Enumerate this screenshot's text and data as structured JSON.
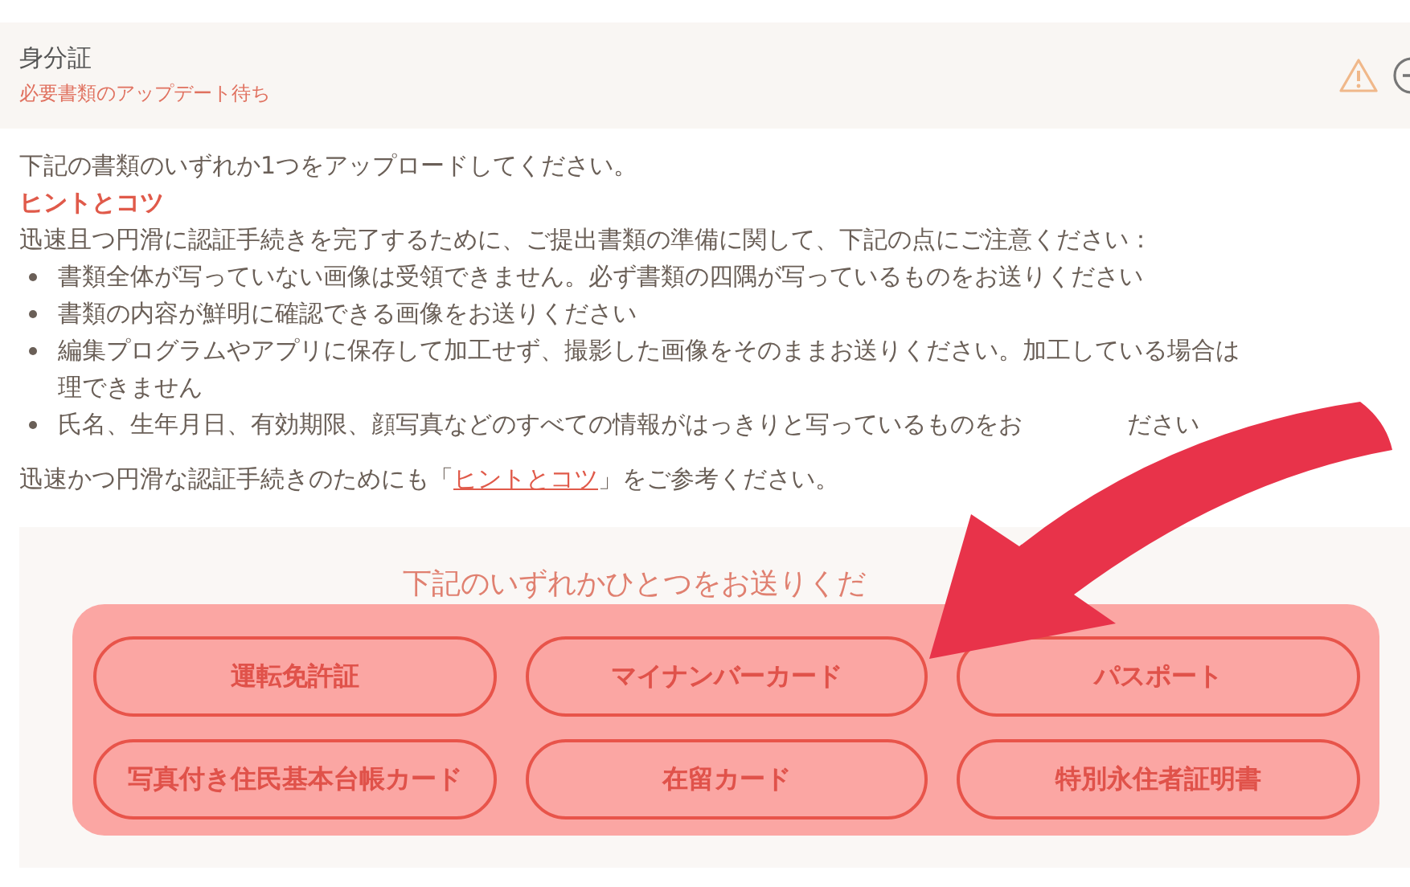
{
  "header": {
    "title": "身分証",
    "status": "必要書類のアップデート待ち"
  },
  "intro": "下記の書類のいずれか1つをアップロードしてください。",
  "hint_heading": "ヒントとコツ",
  "hint_lead": "迅速且つ円滑に認証手続きを完了するために、ご提出書類の準備に関して、下記の点にご注意ください：",
  "bullets": [
    {
      "text": "書類全体が写っていない画像は受領できません。必ず書類の四隅が写っているものをお送りください"
    },
    {
      "text": "書類の内容が鮮明に確認できる画像をお送りください"
    },
    {
      "text": "編集プログラムやアプリに保存して加工せず、撮影した画像をそのままお送りください。加工している場合は",
      "line_2": "理できません"
    },
    {
      "text": "氏名、生年月日、有効期限、顔写真などのすべての情報がはっきりと写っているものをお",
      "after_arrow": "ださい"
    }
  ],
  "footer": {
    "before": "迅速かつ円滑な認証手続きのためにも「",
    "link": "ヒントとコツ",
    "after": "」をご参考ください。"
  },
  "documents": {
    "heading": "下記のいずれかひとつをお送りくだ",
    "buttons": [
      "運転免許証",
      "マイナンバーカード",
      "パスポート",
      "写真付き住民基本台帳カード",
      "在留カード",
      "特別永住者証明書"
    ]
  }
}
